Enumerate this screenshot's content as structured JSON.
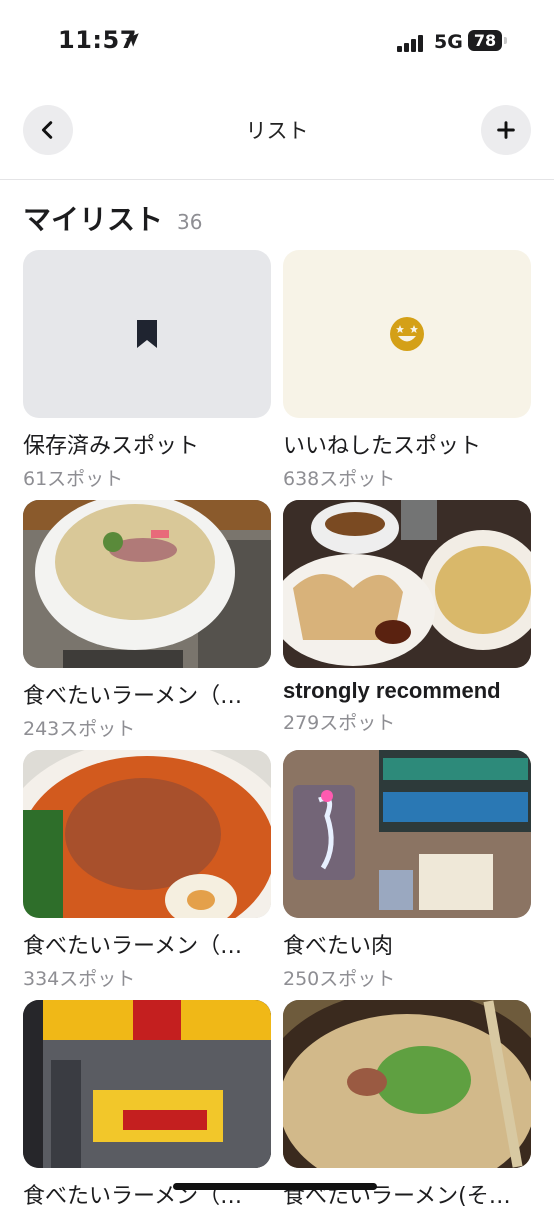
{
  "status_bar": {
    "time": "11:57",
    "network": "5G",
    "battery": "78"
  },
  "nav": {
    "title": "リスト",
    "back_icon": "chevron-left-icon",
    "add_icon": "plus-icon"
  },
  "section": {
    "title": "マイリスト",
    "count": "36"
  },
  "lists": [
    {
      "name": "保存済みスポット",
      "spots": "61スポット",
      "thumb": "bookmark-icon"
    },
    {
      "name": "いいねしたスポット",
      "spots": "638スポット",
      "thumb": "starry-eyed-smile-icon"
    },
    {
      "name": "食べたいラーメン（…",
      "spots": "243スポット",
      "thumb": "photo-shio-ramen"
    },
    {
      "name": "strongly recommend",
      "spots": "279スポット",
      "thumb": "photo-gyoza-fried-rice"
    },
    {
      "name": "食べたいラーメン（…",
      "spots": "334スポット",
      "thumb": "photo-tantanmen"
    },
    {
      "name": "食べたい肉",
      "spots": "250スポット",
      "thumb": "photo-neon-bar"
    },
    {
      "name": "食べたいラーメン（…",
      "spots": "",
      "thumb": "photo-ramen-shop-front"
    },
    {
      "name": "食べたいラーメン(そ…",
      "spots": "",
      "thumb": "photo-miso-ramen"
    }
  ],
  "colors": {
    "saved_bg": "#e6e7ea",
    "liked_bg": "#f7f3e7",
    "liked_icon": "#d4a017",
    "muted_text": "#8e8e93"
  }
}
